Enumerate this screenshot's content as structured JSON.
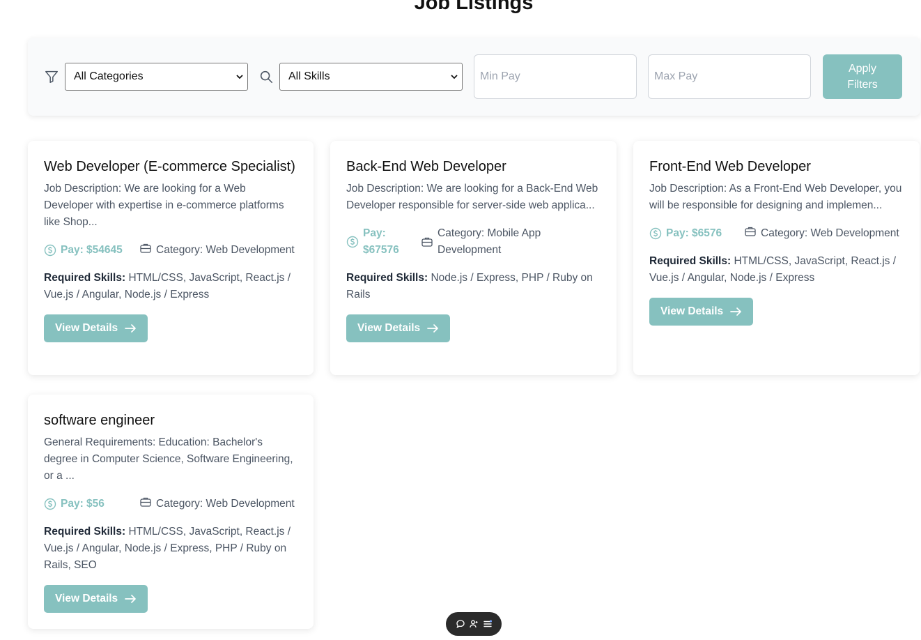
{
  "page": {
    "title": "Job Listings"
  },
  "filters": {
    "category_icon": "filter-icon",
    "category_selected": "All Categories",
    "skills_icon": "search-icon",
    "skills_selected": "All Skills",
    "min_pay_placeholder": "Min Pay",
    "max_pay_placeholder": "Max Pay",
    "apply_label": "Apply\nFilters"
  },
  "jobs": [
    {
      "title": "Web Developer (E-commerce Specialist)",
      "description": "Job Description: We are looking for a Web Developer with expertise in e-commerce platforms like Shop...",
      "pay": "Pay: $54645",
      "category": "Category: Web Development",
      "skills_label": "Required Skills:",
      "skills": "HTML/CSS, JavaScript, React.js / Vue.js / Angular, Node.js / Express",
      "button": "View Details"
    },
    {
      "title": "Back-End Web Developer",
      "description": "Job Description: We are looking for a Back-End Web Developer responsible for server-side web applica...",
      "pay": "Pay: $67576",
      "category": "Category: Mobile App Development",
      "skills_label": "Required Skills:",
      "skills": "Node.js / Express, PHP / Ruby on Rails",
      "button": "View Details"
    },
    {
      "title": "Front-End Web Developer",
      "description": "Job Description: As a Front-End Web Developer, you will be responsible for designing and implemen...",
      "pay": "Pay: $6576",
      "category": "Category: Web Development",
      "skills_label": "Required Skills:",
      "skills": "HTML/CSS, JavaScript, React.js / Vue.js / Angular, Node.js / Express",
      "button": "View Details"
    },
    {
      "title": "software engineer",
      "description": "General Requirements: Education: Bachelor's degree in Computer Science, Software Engineering, or a ...",
      "pay": "Pay: $56",
      "category": "Category: Web Development",
      "skills_label": "Required Skills:",
      "skills": "HTML/CSS, JavaScript, React.js / Vue.js / Angular, Node.js / Express, PHP / Ruby on Rails, SEO",
      "button": "View Details"
    }
  ],
  "colors": {
    "accent": "#86c1bf",
    "muted_text": "#4b5563",
    "filter_bg": "#f9fafb"
  },
  "icons": [
    "filter-icon",
    "search-icon",
    "dollar-circle-icon",
    "briefcase-icon",
    "arrow-right-icon",
    "chat-icon",
    "add-user-icon",
    "menu-icon"
  ]
}
